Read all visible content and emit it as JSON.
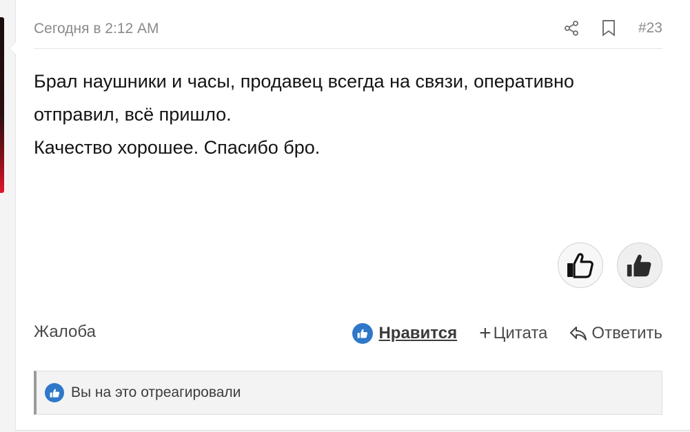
{
  "post": {
    "date": "Сегодня в 2:12 AM",
    "number": "#23",
    "body_lines": [
      "Брал наушники и часы, продавец всегда на связи, оперативно",
      "отправил, всё пришло.",
      "Качество хорошее. Спасибо бро."
    ]
  },
  "footer": {
    "report_label": "Жалоба",
    "like_label": "Нравится",
    "quote_label": "Цитата",
    "reply_label": "Ответить"
  },
  "reaction_summary": {
    "text": "Вы на это отреагировали"
  },
  "icons": {
    "share": "share-icon",
    "bookmark": "bookmark-icon",
    "like_outline": "thumbs-up-outline-icon",
    "like_filled": "thumbs-up-filled-icon",
    "reply": "reply-icon"
  },
  "colors": {
    "accent": "#2f78c9",
    "text": "#141414",
    "muted": "#8a8a8a"
  }
}
